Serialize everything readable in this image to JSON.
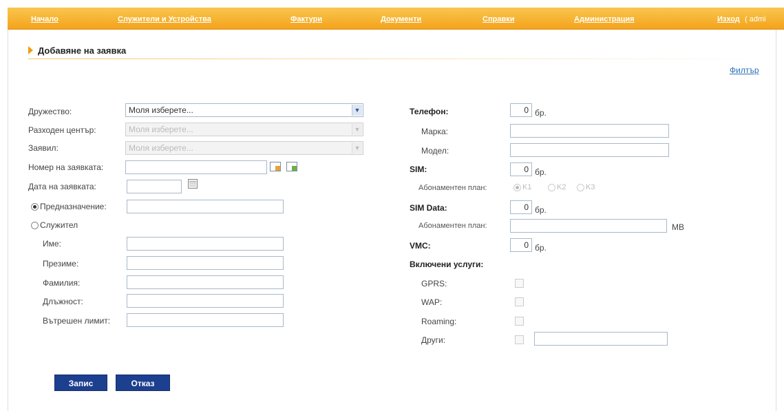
{
  "nav": {
    "items": [
      "Начало",
      "Служители и Устройства",
      "Фактури",
      "Документи",
      "Справки",
      "Администрация",
      "Изход"
    ],
    "user": "( admi"
  },
  "page": {
    "title": "Добавяне на заявка",
    "filter": "Филтър"
  },
  "left": {
    "company_label": "Дружество:",
    "company_value": "Моля изберете...",
    "cost_center_label": "Разходен център:",
    "cost_center_value": "Моля изберете...",
    "requester_label": "Заявил:",
    "requester_value": "Моля изберете...",
    "request_no_label": "Номер на заявката:",
    "request_date_label": "Дата на заявката:",
    "purpose_label": "Предназначение:",
    "employee_label": "Служител",
    "name_label": "Име:",
    "middle_label": "Презиме:",
    "surname_label": "Фамилия:",
    "position_label": "Длъжност:",
    "limit_label": "Вътрешен лимит:"
  },
  "right": {
    "phone_label": "Телефон:",
    "phone_qty": "0",
    "unit": "бр.",
    "brand_label": "Марка:",
    "model_label": "Модел:",
    "sim_label": "SIM:",
    "sim_qty": "0",
    "plan_label": "Абонаментен план:",
    "plan_options": [
      "K1",
      "K2",
      "K3"
    ],
    "simdata_label": "SIM Data:",
    "simdata_qty": "0",
    "plan_label2": "Абонаментен план:",
    "mb": "MB",
    "vms_label": "VMC:",
    "vms_qty": "0",
    "services_label": "Включени услуги:",
    "gprs": "GPRS:",
    "wap": "WAP:",
    "roaming": "Roaming:",
    "other": "Други:"
  },
  "buttons": {
    "save": "Запис",
    "cancel": "Отказ"
  },
  "colors": {
    "nav": "#f4a31c",
    "button": "#1d3f8f",
    "link": "#2a6fb8"
  }
}
